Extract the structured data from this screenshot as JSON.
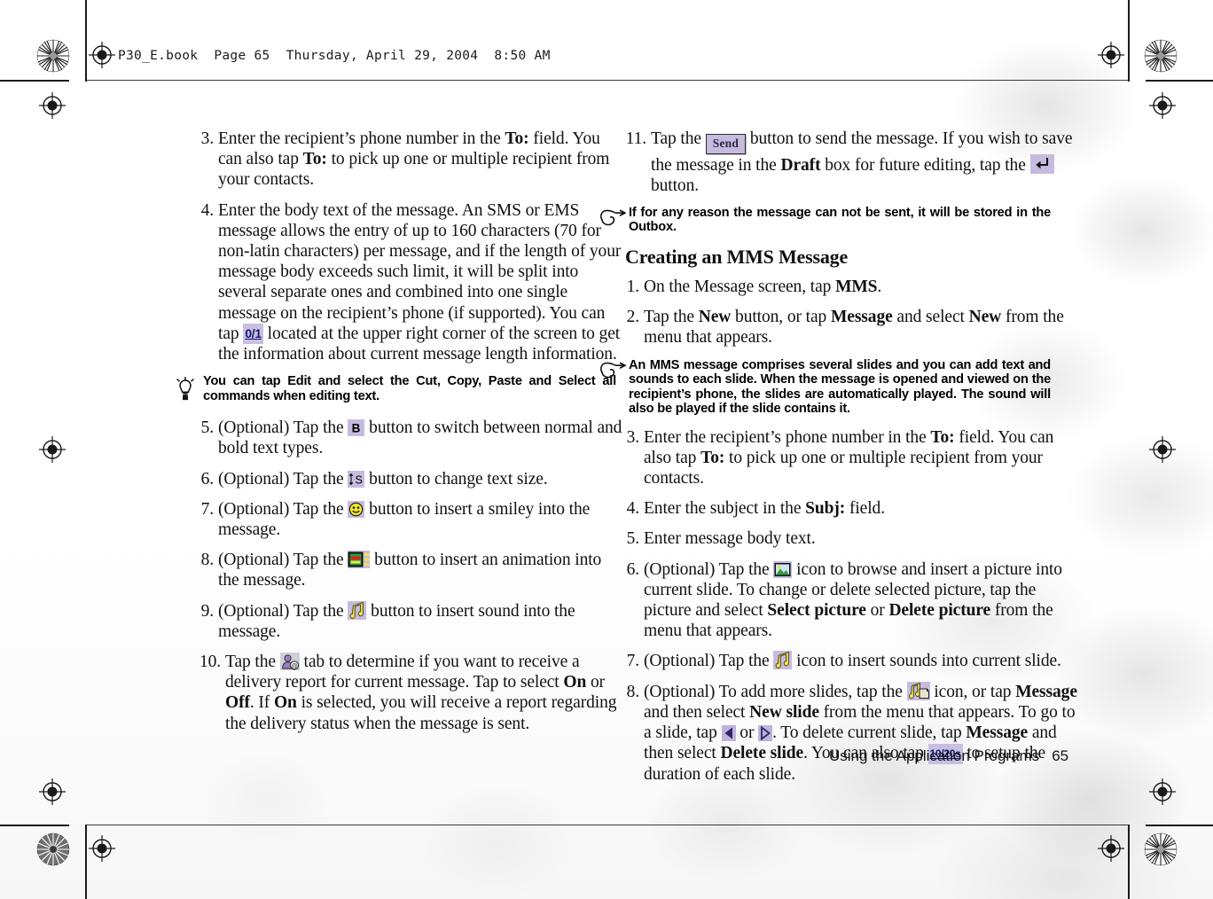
{
  "header": {
    "text": "P30_E.book  Page 65  Thursday, April 29, 2004  8:50 AM"
  },
  "footer": {
    "title": "Using the Application Programs",
    "page_number": "65"
  },
  "colors": {
    "chip_background": "#c6bbdf",
    "highlight_background": "#c9bfe2",
    "highlight_text": "#101a6e",
    "paper": "#ffffff",
    "ink": "#111111"
  },
  "left_column": {
    "steps": [
      {
        "number": "3.",
        "segments": [
          {
            "type": "text",
            "value": "Enter the recipient’s phone number in the "
          },
          {
            "type": "bold",
            "value": "To:"
          },
          {
            "type": "text",
            "value": " field. You can also tap "
          },
          {
            "type": "bold",
            "value": "To:"
          },
          {
            "type": "text",
            "value": " to pick up one or multiple recipient from your contacts."
          }
        ]
      },
      {
        "number": "4.",
        "segments": [
          {
            "type": "text",
            "value": "Enter the body text of the message. An SMS or EMS message allows the entry of up to 160 characters (70 for non-latin characters) per message, and if the length of your message body exceeds such limit, it will be split into several separate ones and combined into one single message on the recipient’s phone (if supported). You can tap "
          },
          {
            "type": "highlight",
            "value": "0/1",
            "icon_name": "message-length-indicator"
          },
          {
            "type": "text",
            "value": " located at the upper right corner of the screen to get the information about current message length information."
          }
        ]
      },
      {
        "number": "5.",
        "segments": [
          {
            "type": "text",
            "value": "(Optional) Tap the "
          },
          {
            "type": "icon",
            "icon_name": "bold-text-button",
            "label": "B"
          },
          {
            "type": "text",
            "value": " button to switch between normal and bold text types."
          }
        ]
      },
      {
        "number": "6.",
        "segments": [
          {
            "type": "text",
            "value": "(Optional) Tap the "
          },
          {
            "type": "icon",
            "icon_name": "text-size-button",
            "label": "↕S"
          },
          {
            "type": "text",
            "value": " button to change text size."
          }
        ]
      },
      {
        "number": "7.",
        "segments": [
          {
            "type": "text",
            "value": "(Optional) Tap the "
          },
          {
            "type": "icon",
            "icon_name": "smiley-button",
            "label": "☺"
          },
          {
            "type": "text",
            "value": " button to insert a smiley into the message."
          }
        ]
      },
      {
        "number": "8.",
        "segments": [
          {
            "type": "text",
            "value": "(Optional) Tap the "
          },
          {
            "type": "icon",
            "icon_name": "animation-button",
            "label": ""
          },
          {
            "type": "text",
            "value": " button to insert an animation into the message."
          }
        ]
      },
      {
        "number": "9.",
        "segments": [
          {
            "type": "text",
            "value": "(Optional) Tap the "
          },
          {
            "type": "icon",
            "icon_name": "insert-sound-button",
            "label": "♫"
          },
          {
            "type": "text",
            "value": " button to insert sound into the message."
          }
        ]
      },
      {
        "number": "10.",
        "segments": [
          {
            "type": "text",
            "value": "Tap the "
          },
          {
            "type": "icon",
            "icon_name": "delivery-report-tab",
            "label": ""
          },
          {
            "type": "text",
            "value": " tab to determine if you want to receive a delivery report for current message. Tap to select "
          },
          {
            "type": "bold",
            "value": "On"
          },
          {
            "type": "text",
            "value": " or "
          },
          {
            "type": "bold",
            "value": "Off"
          },
          {
            "type": "text",
            "value": ". If "
          },
          {
            "type": "bold",
            "value": "On"
          },
          {
            "type": "text",
            "value": " is selected, you will receive a report regarding the delivery status when the message is sent."
          }
        ]
      }
    ],
    "tip_note": {
      "icon_name": "lightbulb-icon",
      "text": "You can tap Edit and select the Cut, Copy, Paste and Select all commands when editing text."
    }
  },
  "right_column": {
    "step_11": {
      "number": "11.",
      "segments": [
        {
          "type": "text",
          "value": "Tap the "
        },
        {
          "type": "icon",
          "icon_name": "send-button",
          "label": "Send"
        },
        {
          "type": "text",
          "value": " button to send the message. If you wish to save the message in the "
        },
        {
          "type": "bold",
          "value": "Draft"
        },
        {
          "type": "text",
          "value": " box for future editing, tap the "
        },
        {
          "type": "icon",
          "icon_name": "save-draft-button",
          "label": "↵"
        },
        {
          "type": "text",
          "value": " button."
        }
      ]
    },
    "note_outbox": {
      "icon_name": "pointing-hand-icon",
      "text": "If for any reason the message can not be sent, it will be stored in the Outbox."
    },
    "section_title": "Creating an MMS Message",
    "note_mms": {
      "icon_name": "pointing-hand-icon",
      "text": "An MMS message comprises several slides and you can add text and sounds to each slide. When the message is opened and viewed on the recipient’s phone, the slides are automatically played. The sound will also be played if the slide contains it."
    },
    "steps": [
      {
        "number": "1.",
        "segments": [
          {
            "type": "text",
            "value": "On the Message screen, tap "
          },
          {
            "type": "bold",
            "value": "MMS"
          },
          {
            "type": "text",
            "value": "."
          }
        ]
      },
      {
        "number": "2.",
        "segments": [
          {
            "type": "text",
            "value": "Tap the "
          },
          {
            "type": "bold",
            "value": "New"
          },
          {
            "type": "text",
            "value": " button, or tap "
          },
          {
            "type": "bold",
            "value": "Message"
          },
          {
            "type": "text",
            "value": " and select "
          },
          {
            "type": "bold",
            "value": "New"
          },
          {
            "type": "text",
            "value": " from the menu that appears."
          }
        ]
      },
      {
        "number": "3.",
        "segments": [
          {
            "type": "text",
            "value": "Enter the recipient’s phone number in the "
          },
          {
            "type": "bold",
            "value": "To:"
          },
          {
            "type": "text",
            "value": " field. You can also tap "
          },
          {
            "type": "bold",
            "value": "To:"
          },
          {
            "type": "text",
            "value": " to pick up one or multiple recipient from your contacts."
          }
        ]
      },
      {
        "number": "4.",
        "segments": [
          {
            "type": "text",
            "value": "Enter the subject in the "
          },
          {
            "type": "bold",
            "value": "Subj:"
          },
          {
            "type": "text",
            "value": " field."
          }
        ]
      },
      {
        "number": "5.",
        "segments": [
          {
            "type": "text",
            "value": "Enter message body text."
          }
        ]
      },
      {
        "number": "6.",
        "segments": [
          {
            "type": "text",
            "value": "(Optional) Tap the "
          },
          {
            "type": "icon",
            "icon_name": "insert-picture-icon",
            "label": ""
          },
          {
            "type": "text",
            "value": " icon to browse and insert a picture into current slide. To change or delete selected picture, tap the picture and select "
          },
          {
            "type": "bold",
            "value": "Select picture"
          },
          {
            "type": "text",
            "value": " or "
          },
          {
            "type": "bold",
            "value": "Delete picture"
          },
          {
            "type": "text",
            "value": " from the menu that appears."
          }
        ]
      },
      {
        "number": "7.",
        "segments": [
          {
            "type": "text",
            "value": "(Optional) Tap the "
          },
          {
            "type": "icon",
            "icon_name": "insert-sound-icon",
            "label": "♫"
          },
          {
            "type": "text",
            "value": " icon to insert sounds into current slide."
          }
        ]
      },
      {
        "number": "8.",
        "segments": [
          {
            "type": "text",
            "value": "(Optional) To add more slides, tap the "
          },
          {
            "type": "icon",
            "icon_name": "new-slide-icon",
            "label": ""
          },
          {
            "type": "text",
            "value": " icon, or tap "
          },
          {
            "type": "bold",
            "value": "Message"
          },
          {
            "type": "text",
            "value": " and then select "
          },
          {
            "type": "bold",
            "value": "New slide"
          },
          {
            "type": "text",
            "value": " from the menu that appears. To go to a slide, tap "
          },
          {
            "type": "icon",
            "icon_name": "previous-slide-arrow",
            "label": "◀"
          },
          {
            "type": "text",
            "value": " or "
          },
          {
            "type": "icon",
            "icon_name": "next-slide-arrow",
            "label": "▶"
          },
          {
            "type": "text",
            "value": ". To delete current slide, tap "
          },
          {
            "type": "bold",
            "value": "Message"
          },
          {
            "type": "text",
            "value": " and then select "
          },
          {
            "type": "bold",
            "value": "Delete slide"
          },
          {
            "type": "text",
            "value": ". You can also tap "
          },
          {
            "type": "highlight_small",
            "value": "10/20s",
            "icon_name": "slide-duration-indicator"
          },
          {
            "type": "text",
            "value": " to setup the duration of each slide."
          }
        ]
      }
    ]
  }
}
